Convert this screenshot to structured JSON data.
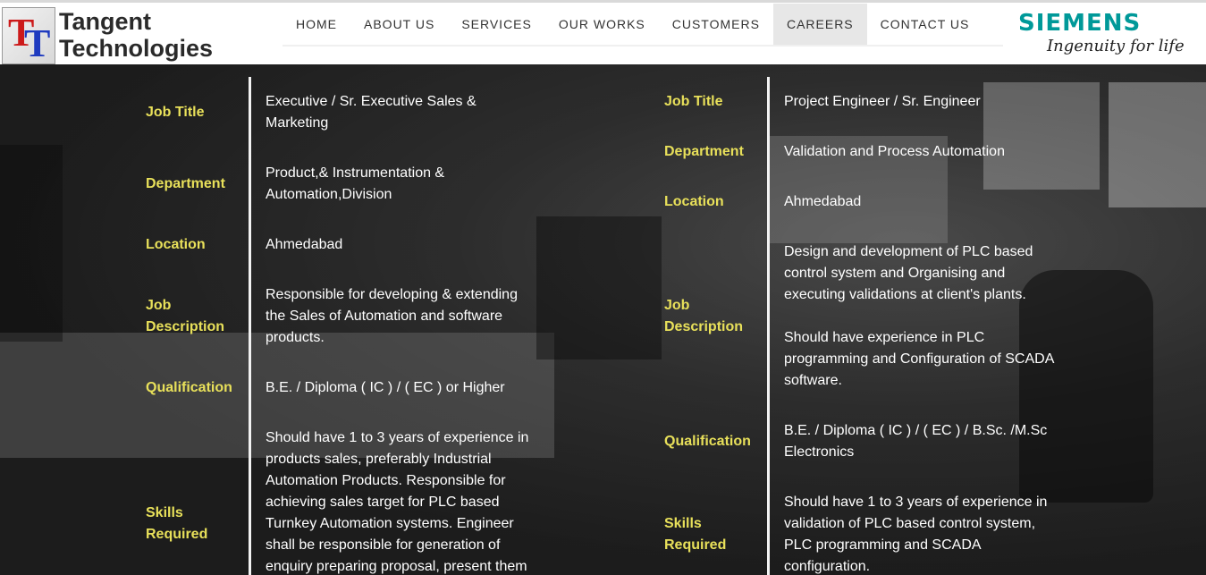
{
  "brand": {
    "mark_left": "T",
    "mark_right": "T",
    "line1": "Tangent",
    "line2": "Technologies"
  },
  "nav": {
    "items": [
      {
        "label": "HOME"
      },
      {
        "label": "ABOUT US"
      },
      {
        "label": "SERVICES"
      },
      {
        "label": "OUR WORKS"
      },
      {
        "label": "CUSTOMERS"
      },
      {
        "label": "CAREERS",
        "active": true
      },
      {
        "label": "CONTACT US"
      }
    ]
  },
  "partner": {
    "name": "SIEMENS",
    "tagline": "Ingenuity for life"
  },
  "jobs": [
    {
      "labels": {
        "title": "Job Title",
        "department": "Department",
        "location": "Location",
        "description_1": "Job",
        "description_2": "Description",
        "qualification": "Qualification",
        "skills_1": "Skills",
        "skills_2": "Required"
      },
      "values": {
        "title_1": "Executive / Sr. Executive Sales &",
        "title_2": "Marketing",
        "department_1": "Product,& Instrumentation &",
        "department_2": "Automation,Division",
        "location": "Ahmedabad",
        "description_1": "Responsible for developing & extending",
        "description_2": "the Sales of Automation and software",
        "description_3": "products.",
        "qualification": "B.E. / Diploma ( IC ) / ( EC ) or Higher",
        "skills_1": "Should have 1 to 3 years of experience in",
        "skills_2": "products sales, preferably Industrial",
        "skills_3": "Automation Products. Responsible for",
        "skills_4": "achieving sales target for PLC based",
        "skills_5": "Turnkey Automation systems. Engineer",
        "skills_6": "shall be responsible for generation of",
        "skills_7": "enquiry preparing proposal, present them"
      }
    },
    {
      "labels": {
        "title": "Job Title",
        "department": "Department",
        "location": "Location",
        "description_1": "Job",
        "description_2": "Description",
        "qualification": "Qualification",
        "skills_1": "Skills",
        "skills_2": "Required"
      },
      "values": {
        "title_1": "Project Engineer / Sr. Engineer",
        "department_1": "Validation and Process Automation",
        "location": "Ahmedabad",
        "description_1": "Design and development of PLC based",
        "description_2": "control system and Organising and",
        "description_3": "executing validations at client's plants.",
        "description_4": "Should have experience in PLC",
        "description_5": "programming and Configuration of SCADA",
        "description_6": "software.",
        "qualification_1": "B.E. / Diploma ( IC ) / ( EC ) / B.Sc. /M.Sc",
        "qualification_2": "Electronics",
        "skills_1": "Should have 1 to 3 years of experience in",
        "skills_2": "validation of PLC based control system,",
        "skills_3": "PLC programming and SCADA",
        "skills_4": "configuration."
      }
    }
  ]
}
